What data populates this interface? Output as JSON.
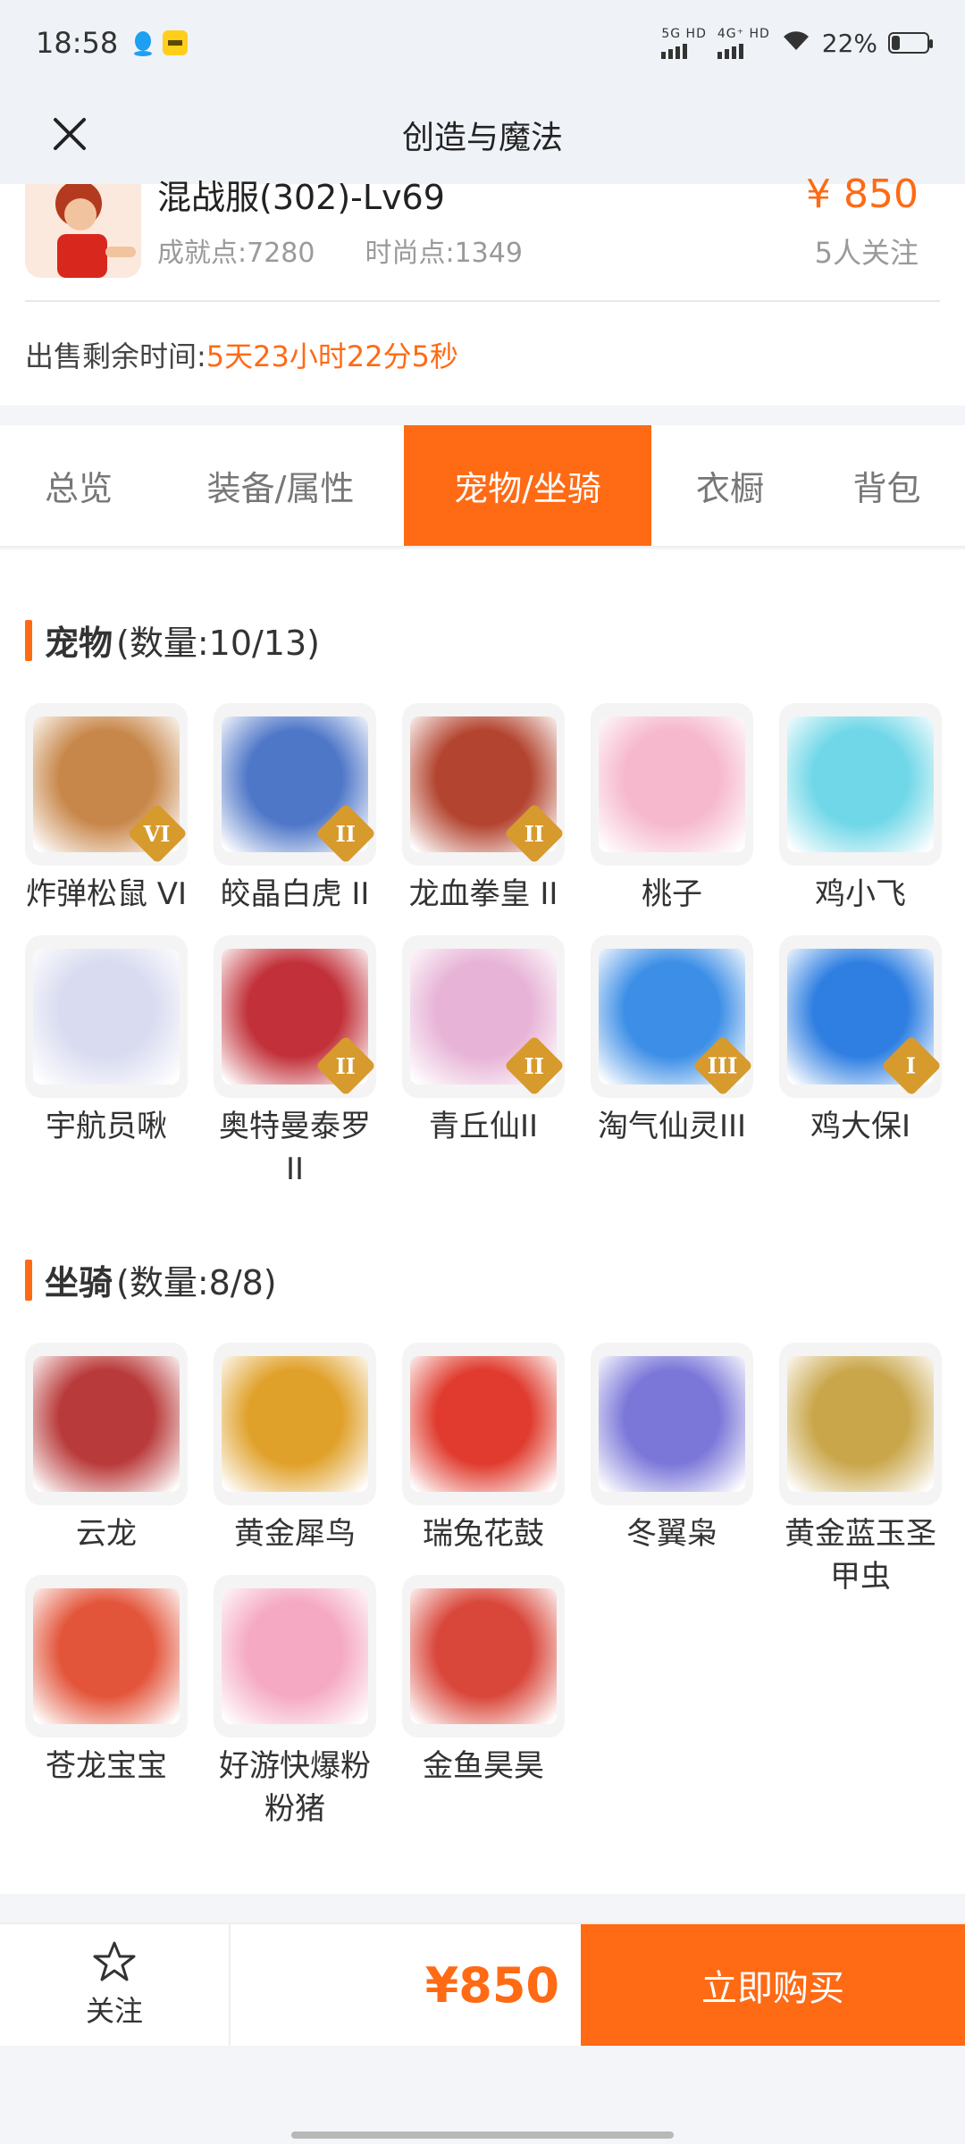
{
  "status_bar": {
    "time": "18:58",
    "net1": "5G HD",
    "net2": "4G⁺ HD",
    "battery": "22%",
    "battery_level": 0.22
  },
  "header": {
    "title": "创造与魔法"
  },
  "listing": {
    "server": "混战服(302)-Lv69",
    "achievement": "成就点:7280",
    "fashion": "时尚点:1349",
    "price": "¥ 850",
    "followers": "5人关注",
    "remain_label": "出售剩余时间:",
    "remain_value": "5天23小时22分5秒"
  },
  "tabs": [
    {
      "label": "总览",
      "active": false
    },
    {
      "label": "装备/属性",
      "active": false
    },
    {
      "label": "宠物/坐骑",
      "active": true
    },
    {
      "label": "衣橱",
      "active": false
    },
    {
      "label": "背包",
      "active": false
    }
  ],
  "pets": {
    "title": "宠物",
    "count": "(数量:10/13)",
    "items": [
      {
        "name": "炸弹松鼠 VI",
        "badge": "VI",
        "color": "#c8874a"
      },
      {
        "name": "皎晶白虎 II",
        "badge": "II",
        "color": "#4f77c8"
      },
      {
        "name": "龙血拳皇 II",
        "badge": "II",
        "color": "#b3442f"
      },
      {
        "name": "桃子",
        "badge": "",
        "color": "#f6b8cc"
      },
      {
        "name": "鸡小飞",
        "badge": "",
        "color": "#6fd7e8"
      },
      {
        "name": "宇航员啾",
        "badge": "",
        "color": "#d9dcf0"
      },
      {
        "name": "奥特曼泰罗 II",
        "badge": "II",
        "color": "#c2313a"
      },
      {
        "name": "青丘仙II",
        "badge": "II",
        "color": "#e7b3d6"
      },
      {
        "name": "淘气仙灵III",
        "badge": "III",
        "color": "#3c8ee6"
      },
      {
        "name": "鸡大保I",
        "badge": "I",
        "color": "#2f7fe2"
      }
    ]
  },
  "mounts": {
    "title": "坐骑",
    "count": "(数量:8/8)",
    "items": [
      {
        "name": "云龙",
        "color": "#b93a3a"
      },
      {
        "name": "黄金犀鸟",
        "color": "#e0a12a"
      },
      {
        "name": "瑞兔花鼓",
        "color": "#e03b2e"
      },
      {
        "name": "冬翼枭",
        "color": "#7b77d9"
      },
      {
        "name": "黄金蓝玉圣甲虫",
        "color": "#c9a64a"
      },
      {
        "name": "苍龙宝宝",
        "color": "#e3553b"
      },
      {
        "name": "好游快爆粉粉猪",
        "color": "#f5a9c3"
      },
      {
        "name": "金鱼昊昊",
        "color": "#d9463a"
      }
    ]
  },
  "bottom": {
    "follow": "关注",
    "price": "¥850",
    "buy": "立即购买"
  },
  "colors": {
    "accent": "#ff6a14"
  }
}
